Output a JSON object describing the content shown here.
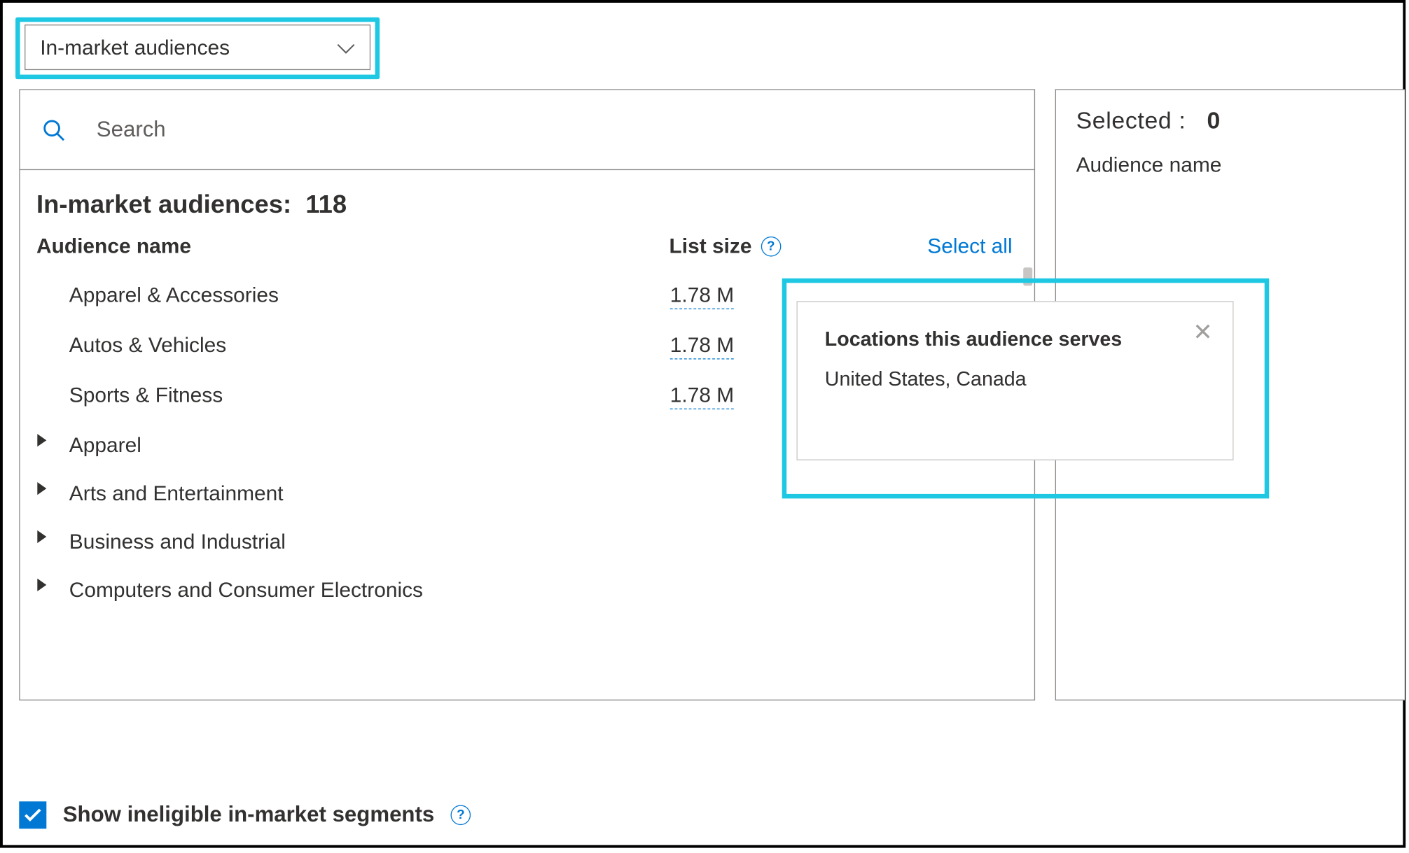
{
  "dropdown": {
    "selected": "In-market audiences"
  },
  "search": {
    "placeholder": "Search"
  },
  "list": {
    "title_prefix": "In-market audiences:",
    "count": "118",
    "col_name": "Audience name",
    "col_size": "List size",
    "select_all": "Select all",
    "rows": [
      {
        "expandable": false,
        "label": "Apparel & Accessories",
        "size": "1.78 M"
      },
      {
        "expandable": false,
        "label": "Autos & Vehicles",
        "size": "1.78 M"
      },
      {
        "expandable": false,
        "label": "Sports & Fitness",
        "size": "1.78 M"
      },
      {
        "expandable": true,
        "label": "Apparel",
        "size": ""
      },
      {
        "expandable": true,
        "label": "Arts and Entertainment",
        "size": ""
      },
      {
        "expandable": true,
        "label": "Business and Industrial",
        "size": ""
      },
      {
        "expandable": true,
        "label": "Computers and Consumer Electronics",
        "size": ""
      }
    ]
  },
  "selected_pane": {
    "label": "Selected :",
    "count": "0",
    "col_name": "Audience name"
  },
  "popup": {
    "title": "Locations this audience serves",
    "body": "United States, Canada"
  },
  "footer": {
    "checkbox_label": "Show ineligible in-market segments",
    "checked": true
  }
}
